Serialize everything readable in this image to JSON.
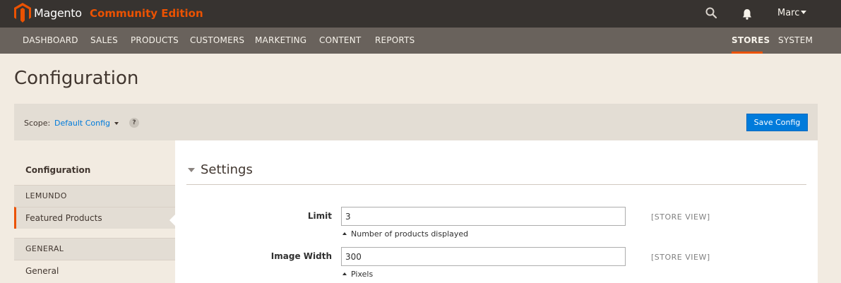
{
  "header": {
    "brand": "Magento",
    "edition": "Community Edition",
    "user": "Marc"
  },
  "nav": {
    "items": [
      "DASHBOARD",
      "SALES",
      "PRODUCTS",
      "CUSTOMERS",
      "MARKETING",
      "CONTENT",
      "REPORTS"
    ],
    "right_items": [
      "STORES",
      "SYSTEM"
    ],
    "active": "STORES"
  },
  "page": {
    "title": "Configuration"
  },
  "scope": {
    "label": "Scope:",
    "value": "Default Config",
    "help": "?",
    "save_label": "Save Config"
  },
  "sidebar": {
    "title": "Configuration",
    "groups": [
      {
        "label": "LEMUNDO",
        "items": [
          "Featured Products"
        ]
      },
      {
        "label": "GENERAL",
        "items": [
          "General"
        ]
      }
    ],
    "active_item": "Featured Products"
  },
  "settings": {
    "title": "Settings",
    "fields": [
      {
        "label": "Limit",
        "value": "3",
        "note": "Number of products displayed",
        "scope": "[STORE VIEW]"
      },
      {
        "label": "Image Width",
        "value": "300",
        "note": "Pixels",
        "scope": "[STORE VIEW]"
      }
    ]
  },
  "colors": {
    "accent": "#eb5202",
    "primary_button": "#007bdb",
    "topbar": "#373330",
    "nav": "#69625c",
    "background": "#f2ebe1"
  }
}
